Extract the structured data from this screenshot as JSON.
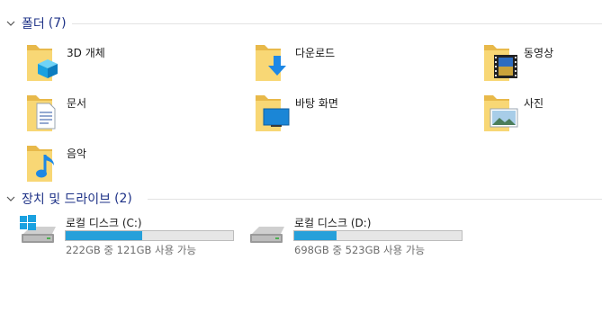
{
  "folders_group": {
    "title": "폴더",
    "count": "(7)"
  },
  "folders": [
    {
      "label": "3D 개체",
      "icon": "3d-objects-icon"
    },
    {
      "label": "다운로드",
      "icon": "downloads-icon"
    },
    {
      "label": "동영상",
      "icon": "videos-icon"
    },
    {
      "label": "문서",
      "icon": "documents-icon"
    },
    {
      "label": "바탕 화면",
      "icon": "desktop-icon"
    },
    {
      "label": "사진",
      "icon": "pictures-icon"
    },
    {
      "label": "음악",
      "icon": "music-icon"
    }
  ],
  "devices_group": {
    "title": "장치 및 드라이브",
    "count": "(2)"
  },
  "drives": [
    {
      "name": "로컬 디스크 (C:)",
      "space": "222GB 중 121GB 사용 가능",
      "used_fraction": 0.455,
      "icon": "windows-drive-icon"
    },
    {
      "name": "로컬 디스크 (D:)",
      "space": "698GB 중 523GB 사용 가능",
      "used_fraction": 0.25,
      "icon": "hard-drive-icon"
    }
  ],
  "colors": {
    "group_header": "#1e3287",
    "bar_fill": "#26a0da",
    "folder": "#f8d775"
  }
}
